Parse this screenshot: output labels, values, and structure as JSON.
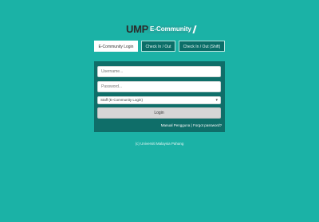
{
  "logo": {
    "primary": "UMP",
    "secondary": "E-Community"
  },
  "tabs": [
    {
      "label": "E-Community Login",
      "active": true
    },
    {
      "label": "Check In / Out",
      "active": false
    },
    {
      "label": "Check In / Out (Shift)",
      "active": false
    }
  ],
  "login_form": {
    "username_placeholder": "Username...",
    "password_placeholder": "Password...",
    "user_type_selected": "Staff (E-Community Login)",
    "login_label": "Login",
    "manual_link": "Manual Pengguna",
    "separator": " | ",
    "forgot_link": "Forgot password?"
  },
  "footer": {
    "copyright": "(c) Universiti Malaysia Pahang"
  },
  "colors": {
    "background": "#1bb2a6",
    "panel": "#0f6e69",
    "tab_inactive": "#0b6e68"
  }
}
